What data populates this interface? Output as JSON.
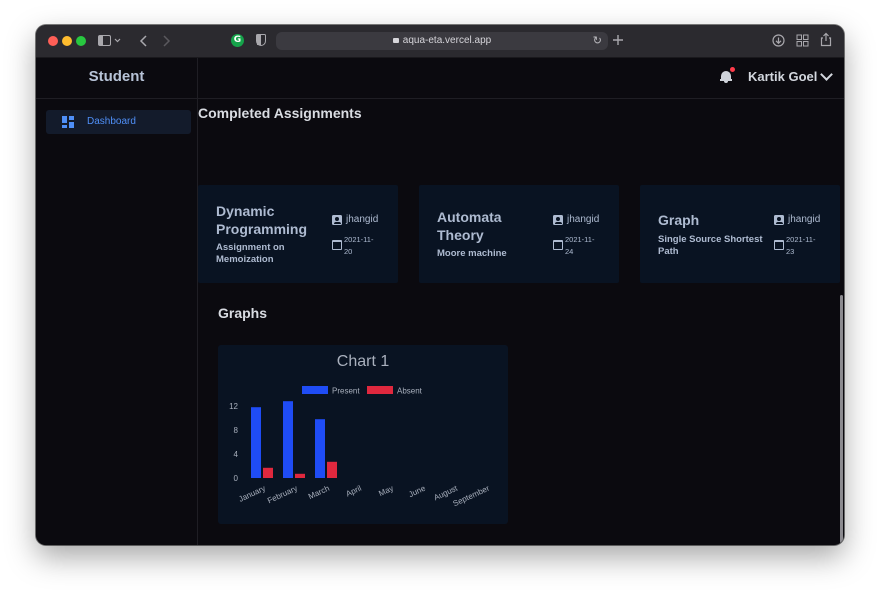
{
  "browser": {
    "url": "aqua-eta.vercel.app"
  },
  "sidebar": {
    "brand": "Student",
    "items": [
      {
        "label": "Dashboard",
        "active": true
      }
    ]
  },
  "header": {
    "user_name": "Kartik Goel",
    "has_notification": true
  },
  "completed": {
    "title": "Completed Assignments",
    "cards": [
      {
        "title": "Dynamic Programming",
        "subtitle": "Assignment on Memoization",
        "user": "jhangid",
        "date": "2021-11-20"
      },
      {
        "title": "Automata Theory",
        "subtitle": "Moore machine",
        "user": "jhangid",
        "date": "2021-11-24"
      },
      {
        "title": "Graph",
        "subtitle": "Single Source Shortest Path",
        "user": "jhangid",
        "date": "2021-11-23"
      }
    ]
  },
  "graphs": {
    "title": "Graphs"
  },
  "colors": {
    "present": "#1f4cf5",
    "absent": "#e0283e",
    "accent": "#4f8ff7"
  },
  "chart_data": {
    "type": "bar",
    "title": "Chart 1",
    "categories": [
      "January",
      "February",
      "March",
      "April",
      "May",
      "June",
      "August",
      "September"
    ],
    "series": [
      {
        "name": "Present",
        "values": [
          11.8,
          12.8,
          9.8,
          0,
          0,
          0,
          0,
          0
        ]
      },
      {
        "name": "Absent",
        "values": [
          1.7,
          0.7,
          2.7,
          0,
          0,
          0,
          0,
          0
        ]
      }
    ],
    "yticks": [
      0,
      4,
      8,
      12
    ],
    "ylim": [
      0,
      13
    ],
    "legend": "top",
    "grid": false
  }
}
